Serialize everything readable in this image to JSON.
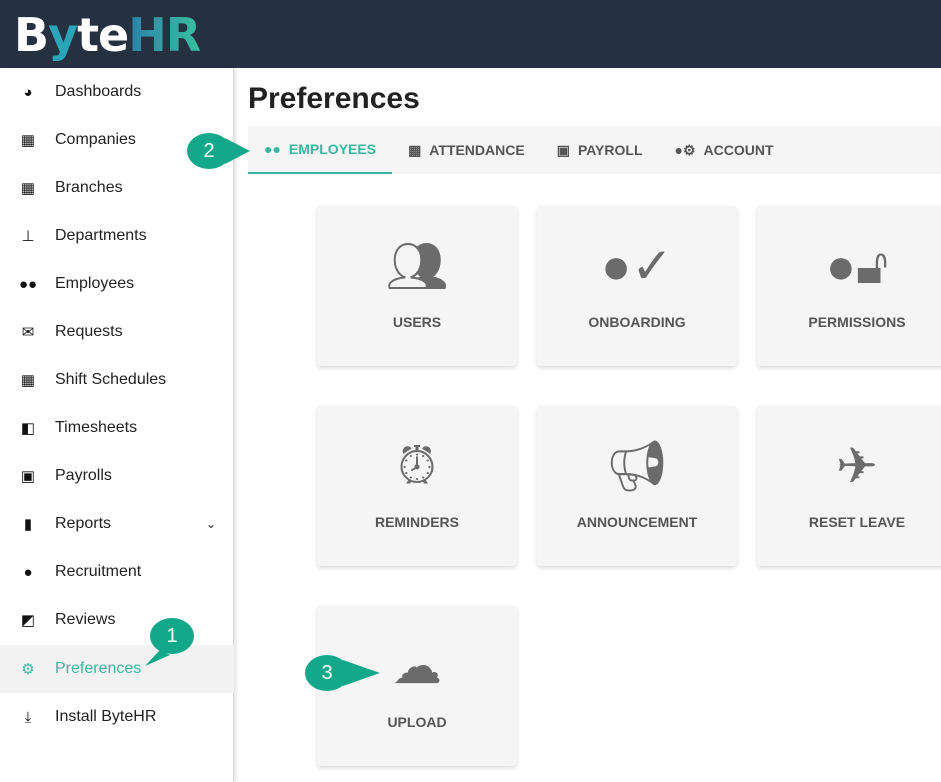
{
  "header": {
    "logo": "ByteHR"
  },
  "sidebar": {
    "items": [
      {
        "label": "Dashboards",
        "icon": "gauge-icon"
      },
      {
        "label": "Companies",
        "icon": "building-flag-icon"
      },
      {
        "label": "Branches",
        "icon": "building-user-icon"
      },
      {
        "label": "Departments",
        "icon": "sitemap-icon"
      },
      {
        "label": "Employees",
        "icon": "users-icon"
      },
      {
        "label": "Requests",
        "icon": "envelope-icon"
      },
      {
        "label": "Shift Schedules",
        "icon": "calendar-icon"
      },
      {
        "label": "Timesheets",
        "icon": "calendar-clock-icon"
      },
      {
        "label": "Payrolls",
        "icon": "money-icon"
      },
      {
        "label": "Reports",
        "icon": "file-icon"
      },
      {
        "label": "Recruitment",
        "icon": "user-search-icon"
      },
      {
        "label": "Reviews",
        "icon": "chart-board-icon"
      },
      {
        "label": "Preferences",
        "icon": "gears-icon",
        "active": true
      },
      {
        "label": "Install ByteHR",
        "icon": "download-icon"
      }
    ]
  },
  "main": {
    "title": "Preferences",
    "tabs": [
      {
        "label": "EMPLOYEES",
        "active": true
      },
      {
        "label": "ATTENDANCE"
      },
      {
        "label": "PAYROLL"
      },
      {
        "label": "ACCOUNT"
      }
    ],
    "cards": [
      {
        "label": "USERS"
      },
      {
        "label": "ONBOARDING"
      },
      {
        "label": "PERMISSIONS"
      },
      {
        "label": "REMINDERS"
      },
      {
        "label": "ANNOUNCEMENT"
      },
      {
        "label": "RESET LEAVE"
      },
      {
        "label": "UPLOAD"
      }
    ]
  },
  "callouts": [
    "1",
    "2",
    "3"
  ],
  "colors": {
    "accent": "#3ab6a0",
    "header": "#253041",
    "callout": "#14a88a"
  }
}
